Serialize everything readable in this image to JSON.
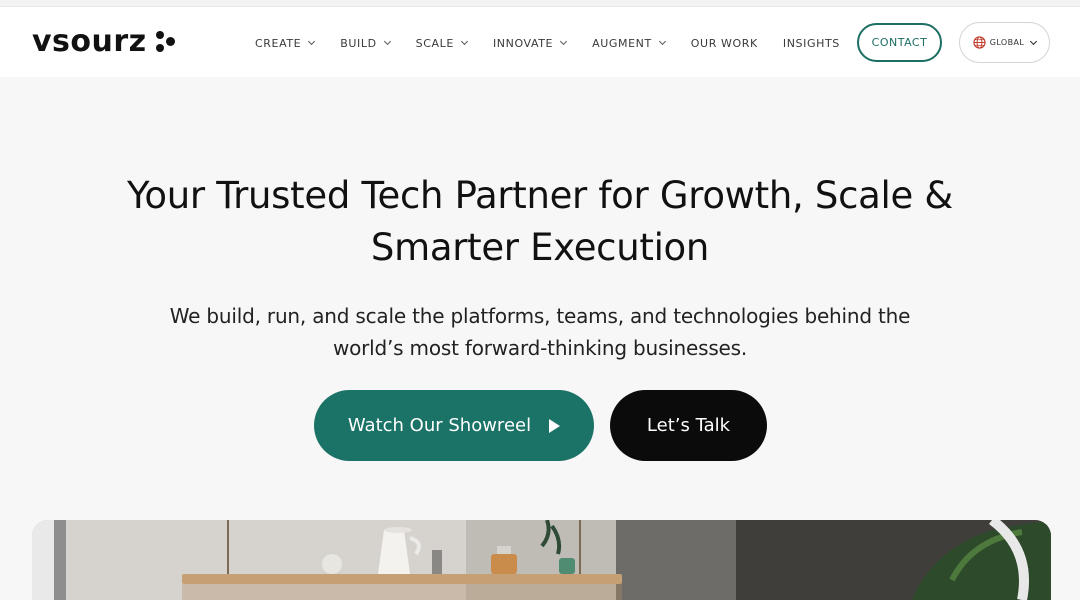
{
  "header": {
    "logo_text": "vsourz",
    "nav": [
      {
        "label": "CREATE",
        "dropdown": true
      },
      {
        "label": "BUILD",
        "dropdown": true
      },
      {
        "label": "SCALE",
        "dropdown": true
      },
      {
        "label": "INNOVATE",
        "dropdown": true
      },
      {
        "label": "AUGMENT",
        "dropdown": true
      },
      {
        "label": "OUR WORK",
        "dropdown": false
      },
      {
        "label": "INSIGHTS",
        "dropdown": false
      }
    ],
    "contact_label": "CONTACT",
    "region_label": "GLOBAL"
  },
  "hero": {
    "title_line1": "Your Trusted Tech Partner for Growth, Scale &",
    "title_line2": "Smarter Execution",
    "subtitle_line1": "We build, run, and scale the platforms, teams, and technologies behind the",
    "subtitle_line2": "world’s most forward-thinking businesses.",
    "primary_button": "Watch Our Showreel",
    "secondary_button": "Let’s Talk"
  },
  "colors": {
    "accent": "#1b7266",
    "dark": "#0b0b0b",
    "background": "#f7f7f7",
    "globe": "#c0392b"
  },
  "icons": {
    "play": "play-icon",
    "globe": "globe-icon",
    "chevron": "chevron-down-icon"
  }
}
